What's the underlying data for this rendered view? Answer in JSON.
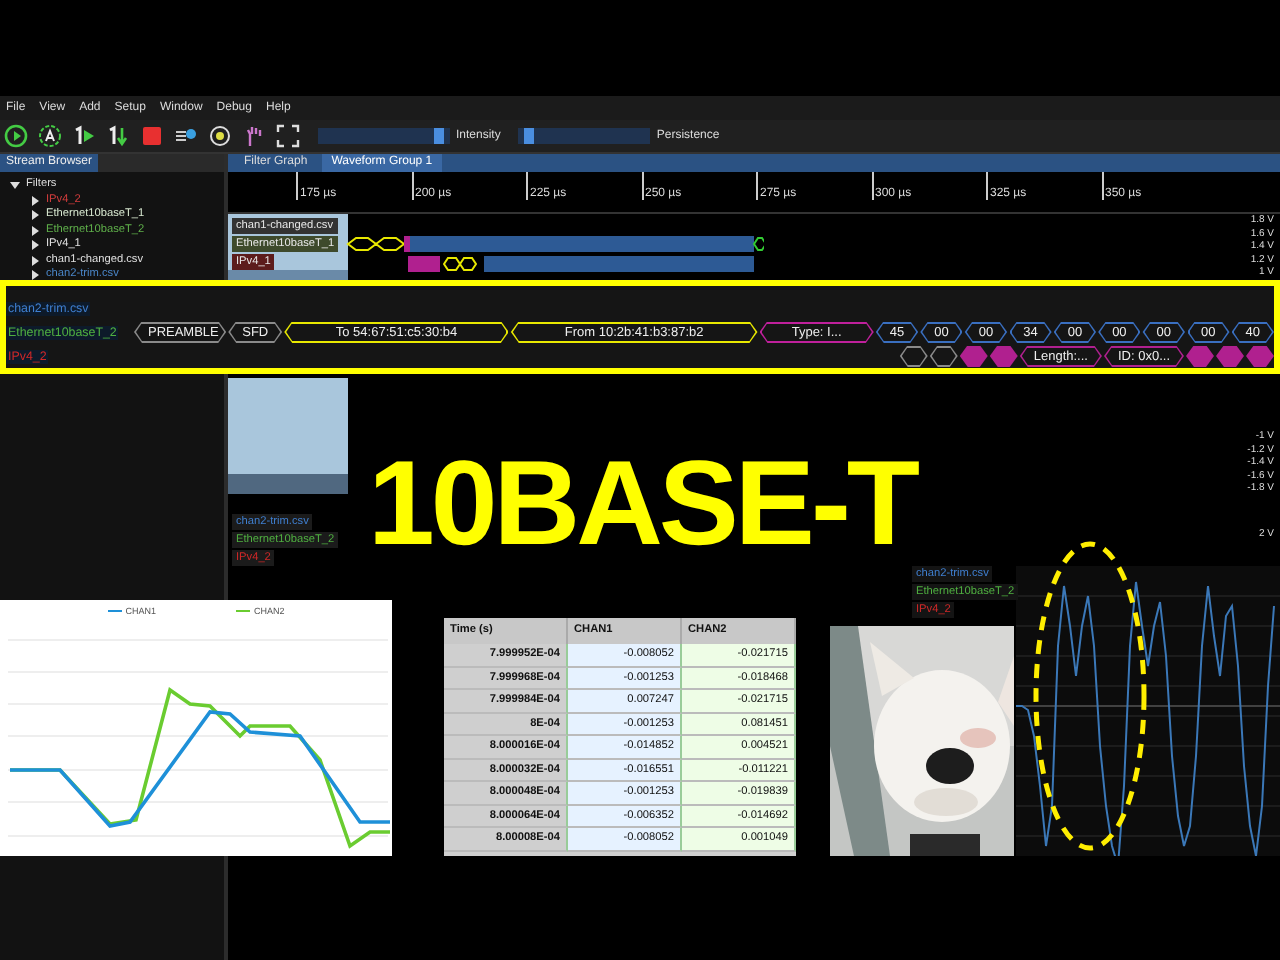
{
  "menu": [
    "File",
    "View",
    "Add",
    "Setup",
    "Window",
    "Debug",
    "Help"
  ],
  "toolbar": {
    "sliders": [
      {
        "label": "Intensity",
        "level": 0.95
      },
      {
        "label": "Persistence",
        "level": 0.04
      }
    ]
  },
  "left_panel": {
    "tab": "Stream Browser",
    "tree": [
      {
        "label": "Filters",
        "expanded": true,
        "children": [
          {
            "label": "IPv4_2",
            "color": "#d23c3c"
          },
          {
            "label": "Ethernet10baseT_1",
            "color": "#d8e8d0"
          },
          {
            "label": "Ethernet10baseT_2",
            "color": "#5fb04a"
          },
          {
            "label": "IPv4_1",
            "color": "#e0e0e0"
          },
          {
            "label": "chan1-changed.csv",
            "color": "#e0e0e0"
          },
          {
            "label": "chan2-trim.csv",
            "color": "#4a86c8"
          }
        ]
      }
    ]
  },
  "tabs": [
    {
      "label": "Filter Graph",
      "selected": false
    },
    {
      "label": "Waveform Group 1",
      "selected": true
    }
  ],
  "ruler": [
    "175 µs",
    "200 µs",
    "225 µs",
    "250 µs",
    "275 µs",
    "300 µs",
    "325 µs",
    "350 µs"
  ],
  "top_traces": [
    {
      "label": "chan1-changed.csv",
      "color": "#333333"
    },
    {
      "label": "Ethernet10baseT_1",
      "color": "#3e4a2c"
    },
    {
      "label": "IPv4_1",
      "color": "#5c1c1c"
    }
  ],
  "top_voltages": [
    "1.8 V",
    "1.6 V",
    "1.4 V",
    "1.2 V",
    "1 V"
  ],
  "zoom_box": {
    "traces": [
      {
        "label": "chan2-trim.csv",
        "color": "#3f7fd0"
      },
      {
        "label": "Ethernet10baseT_2",
        "color": "#4fb040",
        "segments": [
          {
            "text": "PREAMBLE",
            "color": "#8a8a8a",
            "filled": false
          },
          {
            "text": "SFD",
            "color": "#8a8a8a",
            "filled": false
          },
          {
            "text": "To 54:67:51:c5:30:b4",
            "color": "#e8e800",
            "filled": false
          },
          {
            "text": "From 10:2b:41:b3:87:b2",
            "color": "#e8e800",
            "filled": false
          },
          {
            "text": "Type: I...",
            "color": "#c0209c",
            "filled": false
          },
          {
            "text": "45",
            "color": "#3a6fc0",
            "filled": false
          },
          {
            "text": "00",
            "color": "#3a6fc0",
            "filled": false
          },
          {
            "text": "00",
            "color": "#3a6fc0",
            "filled": false
          },
          {
            "text": "34",
            "color": "#3a6fc0",
            "filled": false
          },
          {
            "text": "00",
            "color": "#3a6fc0",
            "filled": false
          },
          {
            "text": "00",
            "color": "#3a6fc0",
            "filled": false
          },
          {
            "text": "00",
            "color": "#3a6fc0",
            "filled": false
          },
          {
            "text": "00",
            "color": "#3a6fc0",
            "filled": false
          },
          {
            "text": "40",
            "color": "#3a6fc0",
            "filled": false
          }
        ]
      },
      {
        "label": "IPv4_2",
        "color": "#d02828",
        "segments": [
          {
            "color": "#8a8a8a",
            "filled": false
          },
          {
            "color": "#8a8a8a",
            "filled": false
          },
          {
            "color": "#b0208f",
            "filled": true
          },
          {
            "color": "#b0208f",
            "filled": true
          },
          {
            "text": "Length:...",
            "color": "#b0208f",
            "filled": false
          },
          {
            "text": "ID: 0x0...",
            "color": "#b0208f",
            "filled": false
          },
          {
            "color": "#b0208f",
            "filled": true
          },
          {
            "color": "#b0208f",
            "filled": true
          },
          {
            "color": "#b0208f",
            "filled": true
          }
        ]
      }
    ]
  },
  "lower_traces": [
    {
      "label": "chan2-trim.csv",
      "color": "#3f7fd0"
    },
    {
      "label": "Ethernet10baseT_2",
      "color": "#4fb040"
    },
    {
      "label": "IPv4_2",
      "color": "#d02828"
    }
  ],
  "lower_voltages": [
    "-1 V",
    "-1.2 V",
    "-1.4 V",
    "-1.6 V",
    "-1.8 V"
  ],
  "lower_voltage_top": "2 V",
  "headline": "10BASE-T",
  "chart": {
    "legend": [
      {
        "name": "CHAN1",
        "color": "#1e90d8"
      },
      {
        "name": "CHAN2",
        "color": "#6acc30"
      }
    ]
  },
  "table": {
    "columns": [
      "Time (s)",
      "CHAN1",
      "CHAN2"
    ],
    "rows": [
      [
        "7.999952E-04",
        "-0.008052",
        "-0.021715"
      ],
      [
        "7.999968E-04",
        "-0.001253",
        "-0.018468"
      ],
      [
        "7.999984E-04",
        "0.007247",
        "-0.021715"
      ],
      [
        "8E-04",
        "-0.001253",
        "0.081451"
      ],
      [
        "8.000016E-04",
        "-0.014852",
        "0.004521"
      ],
      [
        "8.000032E-04",
        "-0.016551",
        "-0.011221"
      ],
      [
        "8.000048E-04",
        "-0.001253",
        "-0.019839"
      ],
      [
        "8.000064E-04",
        "-0.006352",
        "-0.014692"
      ],
      [
        "8.00008E-04",
        "-0.008052",
        "0.001049"
      ]
    ]
  },
  "scope_labels": [
    {
      "label": "chan2-trim.csv",
      "color": "#3f7fd0"
    },
    {
      "label": "Ethernet10baseT_2",
      "color": "#4fb040"
    },
    {
      "label": "IPv4_2",
      "color": "#d02828"
    }
  ]
}
